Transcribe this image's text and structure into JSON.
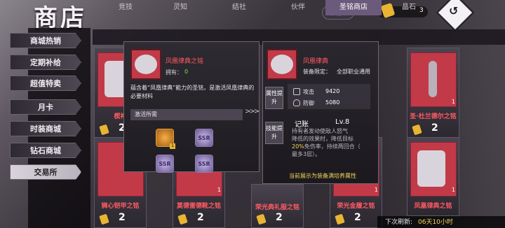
{
  "header": {
    "title": "商店",
    "convert_label": "转换",
    "currency_count": "3"
  },
  "sidebar": {
    "items": [
      {
        "label": "商城热销"
      },
      {
        "label": "定期补给"
      },
      {
        "label": "超值特卖"
      },
      {
        "label": "月卡"
      },
      {
        "label": "时装商城"
      },
      {
        "label": "钻石商城"
      },
      {
        "label": "交易所"
      }
    ]
  },
  "tabs": [
    {
      "label": "竞技"
    },
    {
      "label": "灵知"
    },
    {
      "label": "结社"
    },
    {
      "label": "伙伴"
    },
    {
      "label": "圣铭商店"
    },
    {
      "label": "晶石"
    }
  ],
  "cards_top": [
    {
      "name": "楔神",
      "price": "2",
      "count": ""
    },
    {
      "name": "",
      "price": "",
      "count": ""
    },
    {
      "name": "",
      "price": "",
      "count": ""
    },
    {
      "name": "",
      "price": "",
      "count": ""
    },
    {
      "name": "",
      "price": "",
      "count": ""
    },
    {
      "name": "圣·杜兰德尔之铭",
      "price": "2",
      "count": "1"
    }
  ],
  "cards_bottom": [
    {
      "name": "狮心铠甲之铭",
      "price": "2",
      "count": ""
    },
    {
      "name": "莫德雷德靴之铭",
      "price": "2",
      "count": "1"
    },
    {
      "name": "荣光典礼服之铭",
      "price": "2",
      "count": "1"
    },
    {
      "name": "荣光金履之铭",
      "price": "2",
      "count": "1"
    },
    {
      "name": "凤凰律典之铭",
      "price": "2",
      "count": "1"
    }
  ],
  "popup": {
    "title": "凤凰律典之铭",
    "own_label": "拥有：",
    "own_value": "0",
    "description": "蕴含着“凤凰律典”能力的圣铭，是激活凤凰律典的必要材料",
    "activate_label": "激活所需",
    "materials": [
      {
        "name": "gold-emblem",
        "label": "",
        "count": "1"
      },
      {
        "name": "ssr-token",
        "label": "SSR"
      },
      {
        "name": "ssr-token",
        "label": "SSR"
      },
      {
        "name": "ssr-token",
        "label": "SSR"
      }
    ]
  },
  "equip_panel": {
    "title": "凤凰律典",
    "equip_limit_label": "装备限定：",
    "equip_limit_value": "全部职业通用",
    "attr_tab": "属性提升",
    "skill_tab": "技能提升",
    "stats": [
      {
        "label": "攻击",
        "value": "9420"
      },
      {
        "label": "防御",
        "value": "5080"
      }
    ],
    "skill_name": "记账",
    "skill_level": "Lv.8",
    "skill_desc_1": "持有者发动使敌人怒气",
    "skill_desc_2": "降低的效果时，降低目标",
    "skill_desc_3a": "20%",
    "skill_desc_3b": "免伤率，持续两回合（",
    "skill_desc_4": "最多3层）。",
    "footer": "当前展示为装备满培养属性"
  },
  "refresh": {
    "label": "下次刷新:",
    "time": "06天10小时"
  },
  "colors": {
    "accent_red": "#ff5a62",
    "gold": "#e8b432",
    "highlight_yellow": "#f3d65a",
    "own_green": "#7ce25a"
  }
}
